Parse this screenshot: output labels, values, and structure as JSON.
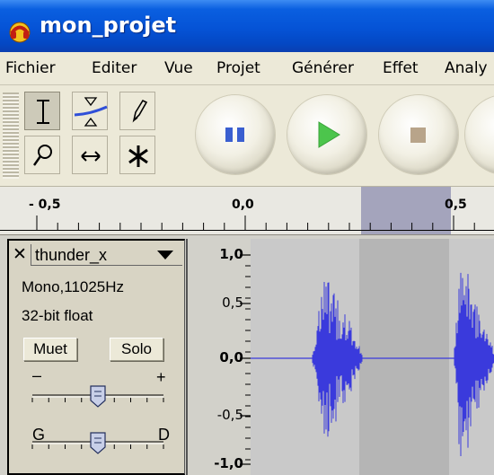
{
  "window": {
    "title": "mon_projet",
    "title_icon": "audacity-headphones-icon"
  },
  "menu": {
    "items": [
      "Fichier",
      "Editer",
      "Vue",
      "Projet",
      "Générer",
      "Effet",
      "Analy"
    ]
  },
  "toolbar": {
    "tools": [
      {
        "icon": "selection-tool-icon",
        "active": true
      },
      {
        "icon": "envelope-tool-icon",
        "active": false
      },
      {
        "icon": "draw-pencil-icon",
        "active": false
      },
      {
        "icon": "zoom-magnifier-icon",
        "active": false
      },
      {
        "icon": "time-shift-icon",
        "active": false
      },
      {
        "icon": "multi-tool-icon",
        "active": false
      }
    ],
    "transport": [
      {
        "icon": "pause-icon",
        "color": "#3a5fd0"
      },
      {
        "icon": "play-icon",
        "color": "#4cc54c"
      },
      {
        "icon": "stop-icon",
        "color": "#b8a48a"
      }
    ]
  },
  "ruler": {
    "labels": [
      "- 0,5",
      "0,0",
      "0,5"
    ],
    "selection_color": "#a4a4bc"
  },
  "track": {
    "name": "thunder_x",
    "format": "Mono,11025Hz",
    "bit_depth": "32-bit float",
    "mute_label": "Muet",
    "solo_label": "Solo",
    "gain": {
      "min_label": "–",
      "max_label": "+",
      "value_fraction": 0.5
    },
    "pan": {
      "left_label": "G",
      "right_label": "D",
      "value_fraction": 0.5
    },
    "scale_labels": [
      "1,0",
      "0,5",
      "0,0",
      "-0,5",
      "-1,0"
    ],
    "waveform_color": "#3a3adc",
    "background_color": "#c9c9c9",
    "selection_color": "#b5b5b5"
  }
}
